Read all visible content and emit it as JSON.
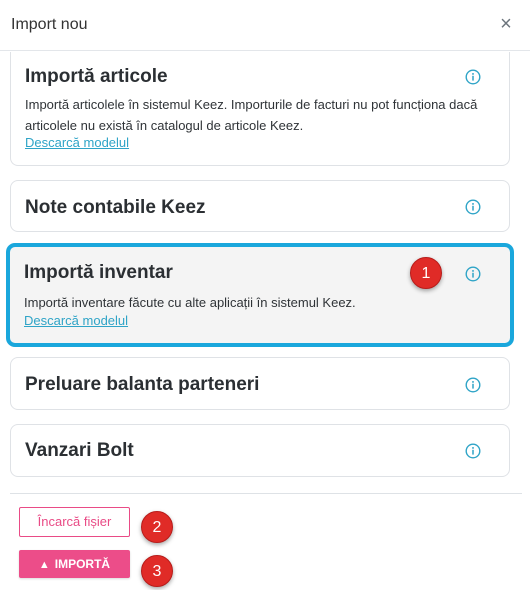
{
  "header": {
    "title": "Import nou",
    "close_label": "×"
  },
  "cards": [
    {
      "title": "Importă articole",
      "description": "Importă articolele în sistemul Keez. Importurile de facturi nu pot funcționa dacă articolele nu există în catalogul de articole Keez.",
      "link": "Descarcă modelul",
      "icon": "info-icon"
    },
    {
      "title": "Note contabile Keez",
      "icon": "info-icon"
    },
    {
      "title": "Importă inventar",
      "description": "Importă inventare făcute cu alte aplicații în sistemul Keez.",
      "link": "Descarcă modelul",
      "icon": "info-icon",
      "selected": true
    },
    {
      "title": "Preluare balanta parteneri",
      "icon": "info-icon"
    },
    {
      "title": "Vanzari Bolt",
      "icon": "info-icon"
    }
  ],
  "footer": {
    "upload_label": "Încarcă fișier",
    "import_label": "IMPORTĂ",
    "import_icon": "upload-arrow-icon"
  },
  "annotations": {
    "badge_1": "1",
    "badge_2": "2",
    "badge_3": "3"
  },
  "colors": {
    "accent_pink": "#ec4d89",
    "highlight_blue": "#1aa7dc",
    "link_blue": "#2fa4c7",
    "badge_red": "#e02b27"
  }
}
